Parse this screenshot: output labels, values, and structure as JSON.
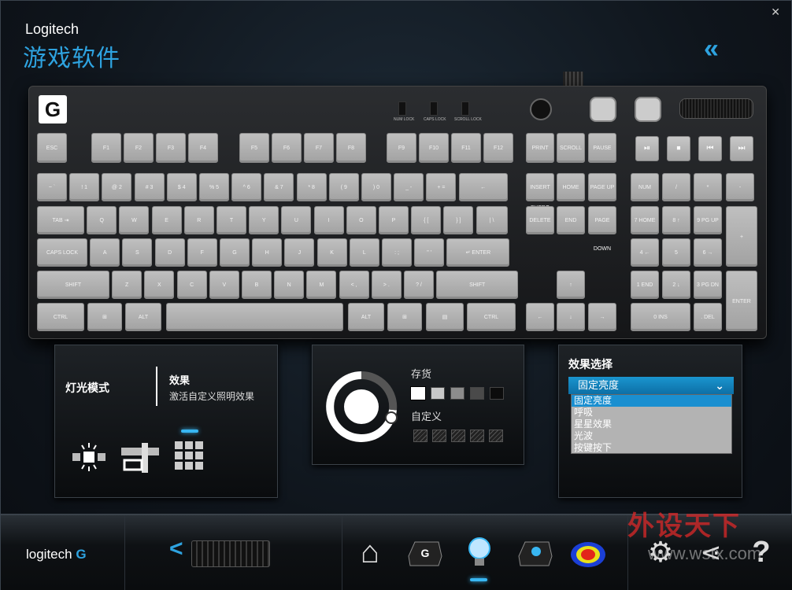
{
  "header": {
    "brand": "Logitech",
    "title": "游戏软件",
    "close": "✕",
    "back": "«"
  },
  "keyboard": {
    "leds": [
      "NUM LOCK",
      "CAPS LOCK",
      "SCROLL LOCK"
    ],
    "f_row": [
      "ESC",
      "F1",
      "F2",
      "F3",
      "F4",
      "F5",
      "F6",
      "F7",
      "F8",
      "F9",
      "F10",
      "F11",
      "F12"
    ],
    "sys_keys": [
      "PRINT SCRN SYSRQ",
      "SCROLL LOCK",
      "PAUSE BREAK"
    ],
    "media": [
      "⏯",
      "⏹",
      "⏮",
      "⏭"
    ],
    "num_row": [
      "~ `",
      "! 1",
      "@ 2",
      "# 3",
      "$ 4",
      "% 5",
      "^ 6",
      "& 7",
      "* 8",
      "( 9",
      ") 0",
      "_ -",
      "+ =",
      "←"
    ],
    "q_row": [
      "TAB ⇥",
      "Q",
      "W",
      "E",
      "R",
      "T",
      "Y",
      "U",
      "I",
      "O",
      "P",
      "{ [",
      "} ]",
      "| \\"
    ],
    "a_row": [
      "CAPS LOCK",
      "A",
      "S",
      "D",
      "F",
      "G",
      "H",
      "J",
      "K",
      "L",
      ": ;",
      "\" '",
      "↵ ENTER"
    ],
    "z_row": [
      "SHIFT",
      "Z",
      "X",
      "C",
      "V",
      "B",
      "N",
      "M",
      "< ,",
      "> .",
      "? /",
      "SHIFT"
    ],
    "ctrl_row": [
      "CTRL",
      "⊞",
      "ALT",
      "",
      "ALT",
      "⊞",
      "▤",
      "CTRL"
    ],
    "nav_top": [
      "INSERT",
      "HOME",
      "PAGE UP"
    ],
    "nav_bot": [
      "DELETE",
      "END",
      "PAGE DOWN"
    ],
    "arrows": [
      "↑",
      "←",
      "↓",
      "→"
    ],
    "numpad_top": [
      "NUM LOCK",
      "/",
      "*",
      "-"
    ],
    "numpad_r1": [
      "7 HOME",
      "8 ↑",
      "9 PG UP",
      "+"
    ],
    "numpad_r2": [
      "4 ←",
      "5",
      "6 →"
    ],
    "numpad_r3": [
      "1 END",
      "2 ↓",
      "3 PG DN",
      "ENTER"
    ],
    "numpad_r4": [
      "0 INS",
      ". DEL"
    ]
  },
  "panel_mode": {
    "label": "灯光模式",
    "effect_title": "效果",
    "effect_desc": "激活自定义照明效果"
  },
  "panel_color": {
    "saved_label": "存货",
    "custom_label": "自定义",
    "saved_colors": [
      "#ffffff",
      "#c8c8c8",
      "#8c8c8c",
      "#4a4a4a",
      "#0c0c0c"
    ]
  },
  "panel_effect": {
    "title": "效果选择",
    "selected": "固定亮度",
    "options": [
      "固定亮度",
      "呼吸",
      "星星效果",
      "光波",
      "按键按下"
    ]
  },
  "footer": {
    "logo_text": "logitech",
    "logo_mark": "G",
    "nav_prev": "<",
    "icons": [
      "home-icon",
      "g-key-icon",
      "lighting-icon",
      "gkey-blue-icon",
      "heatmap-icon",
      "settings-icon",
      "share-icon",
      "help-icon"
    ]
  },
  "watermark": {
    "cn": "外设天下",
    "url": "www.wstx.com"
  }
}
